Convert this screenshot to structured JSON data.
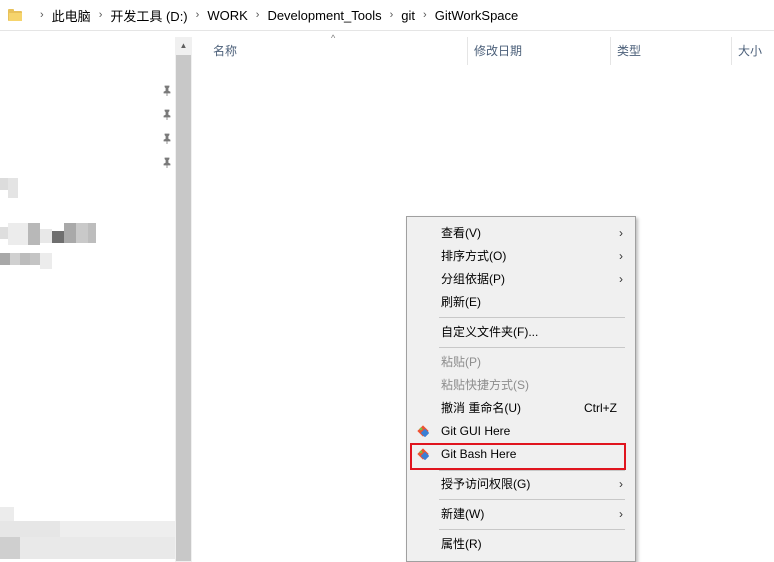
{
  "address_bar": {
    "crumbs": [
      "此电脑",
      "开发工具 (D:)",
      "WORK",
      "Development_Tools",
      "git",
      "GitWorkSpace"
    ],
    "separator": "›"
  },
  "columns": {
    "name": "名称",
    "date_modified": "修改日期",
    "type": "类型",
    "size": "大小"
  },
  "context_menu": {
    "items": [
      {
        "label": "查看(V)",
        "submenu": true
      },
      {
        "label": "排序方式(O)",
        "submenu": true
      },
      {
        "label": "分组依据(P)",
        "submenu": true
      },
      {
        "label": "刷新(E)"
      },
      {
        "label": "自定义文件夹(F)..."
      },
      {
        "label": "粘贴(P)",
        "disabled": true
      },
      {
        "label": "粘贴快捷方式(S)",
        "disabled": true
      },
      {
        "label": "撤消 重命名(U)",
        "shortcut": "Ctrl+Z"
      },
      {
        "label": "Git GUI Here",
        "icon": "git-icon"
      },
      {
        "label": "Git Bash Here",
        "icon": "git-icon",
        "highlighted": true
      },
      {
        "label": "授予访问权限(G)",
        "submenu": true
      },
      {
        "label": "新建(W)",
        "submenu": true
      },
      {
        "label": "属性(R)"
      }
    ],
    "submenu_arrow": "›",
    "highlight_color": "#e0141e"
  },
  "colors": {
    "header_text": "#4c607a",
    "menu_bg": "#f0f0f0",
    "git_orange": "#f05133",
    "git_blue": "#3a7fd5"
  }
}
